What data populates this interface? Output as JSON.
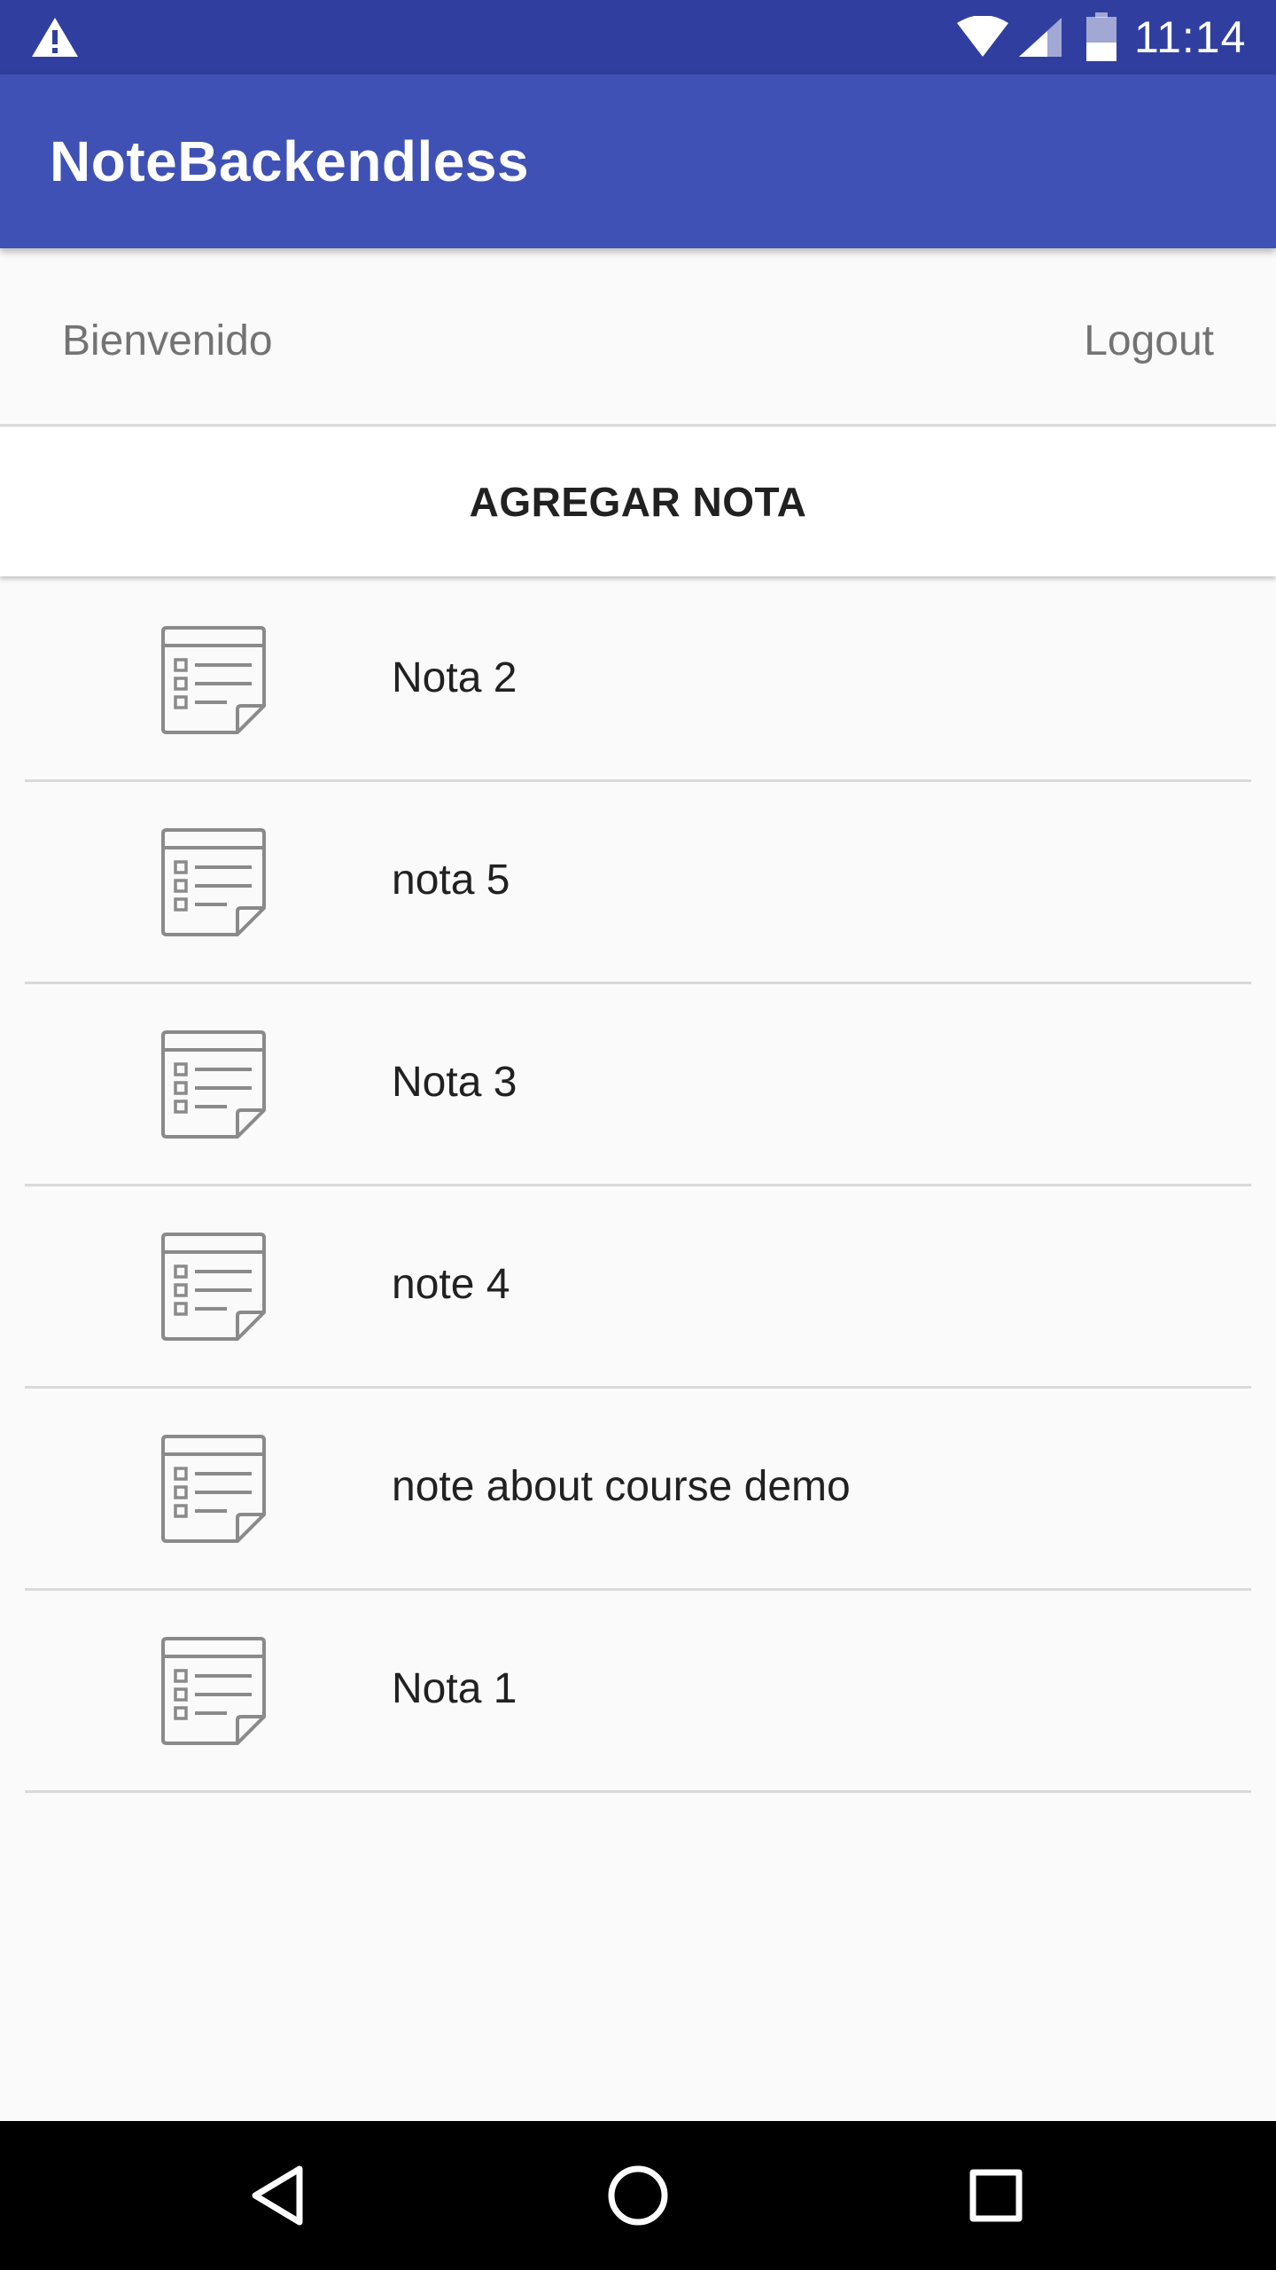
{
  "status_bar": {
    "time": "11:14",
    "icons": [
      "warning-icon",
      "wifi-icon",
      "cell-signal-icon",
      "battery-icon"
    ]
  },
  "app_bar": {
    "title": "NoteBackendless",
    "color": "#3f51b5",
    "status_color": "#303f9f"
  },
  "user_row": {
    "welcome": "Bienvenido",
    "logout": "Logout"
  },
  "add_note": {
    "label": "AGREGAR NOTA"
  },
  "notes": [
    {
      "title": "Nota 2",
      "icon": "note-icon"
    },
    {
      "title": "nota 5",
      "icon": "note-icon"
    },
    {
      "title": "Nota 3",
      "icon": "note-icon"
    },
    {
      "title": "note 4",
      "icon": "note-icon"
    },
    {
      "title": "note about course demo",
      "icon": "note-icon"
    },
    {
      "title": "Nota 1",
      "icon": "note-icon"
    }
  ],
  "nav_bar": {
    "buttons": [
      "back-icon",
      "home-icon",
      "recents-icon"
    ]
  }
}
